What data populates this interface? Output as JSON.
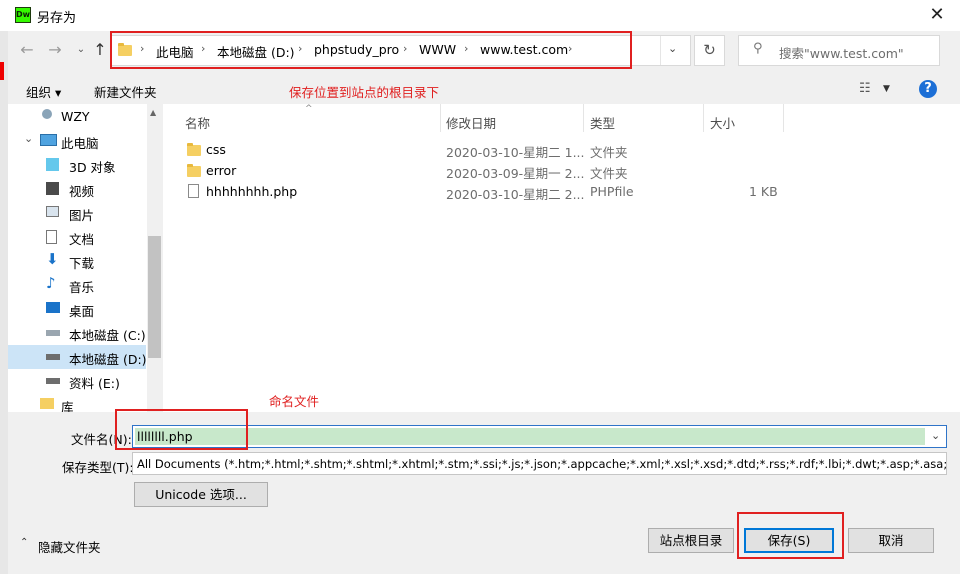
{
  "window": {
    "title": "另存为",
    "app_icon_text": "Dw"
  },
  "address_bar": {
    "crumbs": [
      "此电脑",
      "本地磁盘 (D:)",
      "phpstudy_pro",
      "WWW",
      "www.test.com"
    ]
  },
  "search": {
    "placeholder": "搜索\"www.test.com\""
  },
  "toolbar": {
    "organize_label": "组织 ▾",
    "new_folder_label": "新建文件夹"
  },
  "annotations": {
    "save_location": "保存位置到站点的根目录下",
    "name_file": "命名文件"
  },
  "nav": {
    "items": [
      {
        "label": "WZY",
        "icon": "user-icon"
      },
      {
        "label": "此电脑",
        "icon": "computer-icon"
      },
      {
        "label": "3D 对象",
        "icon": "cube-icon"
      },
      {
        "label": "视频",
        "icon": "video-icon"
      },
      {
        "label": "图片",
        "icon": "picture-icon"
      },
      {
        "label": "文档",
        "icon": "document-icon"
      },
      {
        "label": "下载",
        "icon": "download-icon"
      },
      {
        "label": "音乐",
        "icon": "music-icon"
      },
      {
        "label": "桌面",
        "icon": "desktop-icon"
      },
      {
        "label": "本地磁盘 (C:)",
        "icon": "drive-icon"
      },
      {
        "label": "本地磁盘 (D:)",
        "icon": "drive-icon",
        "selected": true
      },
      {
        "label": "资料 (E:)",
        "icon": "drive-icon"
      },
      {
        "label": "库",
        "icon": "library-icon"
      }
    ]
  },
  "file_list": {
    "columns": [
      "名称",
      "修改日期",
      "类型",
      "大小"
    ],
    "rows": [
      {
        "name": "css",
        "date": "2020-03-10-星期二 1...",
        "type": "文件夹",
        "size": "",
        "icon": "folder-icon"
      },
      {
        "name": "error",
        "date": "2020-03-09-星期一 2...",
        "type": "文件夹",
        "size": "",
        "icon": "folder-icon"
      },
      {
        "name": "hhhhhhhh.php",
        "date": "2020-03-10-星期二 2...",
        "type": "PHPfile",
        "size": "1 KB",
        "icon": "file-icon"
      }
    ]
  },
  "form": {
    "filename_label": "文件名(N):",
    "filename_value": "llllllll.php",
    "filetype_label": "保存类型(T):",
    "filetype_value": "All Documents (*.htm;*.html;*.shtm;*.shtml;*.xhtml;*.stm;*.ssi;*.js;*.json;*.appcache;*.xml;*.xsl;*.xsd;*.dtd;*.rss;*.rdf;*.lbi;*.dwt;*.asp;*.asa;*.aspx",
    "unicode_button": "Unicode 选项..."
  },
  "footer": {
    "hide_folders_label": "隐藏文件夹",
    "site_root_button": "站点根目录",
    "save_button": "保存(S)",
    "cancel_button": "取消"
  },
  "colors": {
    "accent": "#0078d7",
    "annotation_red": "#e02020",
    "selection": "#cce4f7",
    "filename_highlight": "#c8e8cb"
  }
}
